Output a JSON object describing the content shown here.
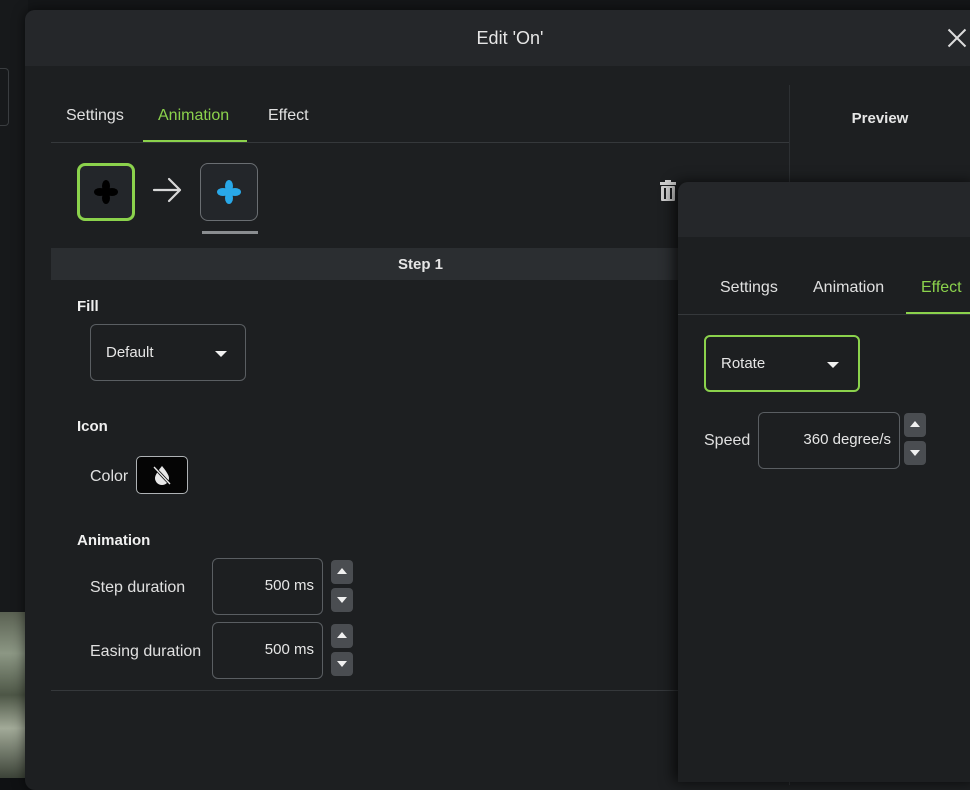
{
  "dialog": {
    "title": "Edit 'On'",
    "tabs": [
      {
        "label": "Settings",
        "active": false
      },
      {
        "label": "Animation",
        "active": true
      },
      {
        "label": "Effect",
        "active": false
      }
    ],
    "preview_label": "Preview",
    "step_header": "Step 1",
    "fill": {
      "section_label": "Fill",
      "selected": "Default"
    },
    "icon": {
      "section_label": "Icon",
      "color_label": "Color"
    },
    "animation": {
      "section_label": "Animation",
      "step_duration_label": "Step duration",
      "step_duration_value": "500 ms",
      "easing_duration_label": "Easing duration",
      "easing_duration_value": "500 ms"
    }
  },
  "effect_dialog": {
    "tabs": [
      {
        "label": "Settings",
        "active": false
      },
      {
        "label": "Animation",
        "active": false
      },
      {
        "label": "Effect",
        "active": true
      }
    ],
    "effect_selected": "Rotate",
    "speed_label": "Speed",
    "speed_value": "360 degree/s"
  },
  "icons": {
    "close": "close-icon",
    "fan": "fan-icon",
    "arrow": "arrow-right-icon",
    "trash": "trash-icon",
    "color_disabled": "no-color-icon"
  },
  "colors": {
    "accent": "#8bd24c",
    "fan_default": "#000000",
    "fan_active": "#29a8e8",
    "dialog_bg": "#1d1f21"
  }
}
